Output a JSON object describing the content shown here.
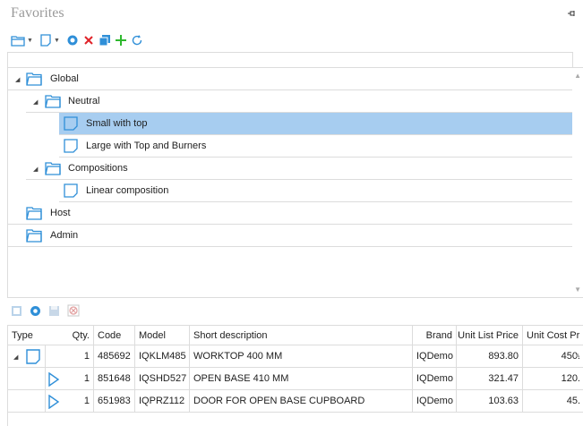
{
  "panel": {
    "title": "Favorites"
  },
  "tree": {
    "items": [
      {
        "label": "Global",
        "kind": "folder",
        "level": 0,
        "expanded": true,
        "selected": false
      },
      {
        "label": "Neutral",
        "kind": "folder",
        "level": 1,
        "expanded": true,
        "selected": false
      },
      {
        "label": "Small with top",
        "kind": "document",
        "level": 2,
        "selected": true
      },
      {
        "label": "Large with Top and Burners",
        "kind": "document",
        "level": 2,
        "selected": false
      },
      {
        "label": "Compositions",
        "kind": "folder",
        "level": 1,
        "expanded": true,
        "selected": false
      },
      {
        "label": "Linear composition",
        "kind": "document",
        "level": 2,
        "selected": false
      },
      {
        "label": "Host",
        "kind": "folder",
        "level": 0,
        "selected": false
      },
      {
        "label": "Admin",
        "kind": "folder",
        "level": 0,
        "selected": false
      }
    ]
  },
  "grid": {
    "columns": {
      "type": "Type",
      "qty": "Qty.",
      "code": "Code",
      "model": "Model",
      "desc": "Short description",
      "brand": "Brand",
      "ulp": "Unit List Price",
      "ucp": "Unit Cost Pr"
    },
    "rows": [
      {
        "qty": "1",
        "code": "485692",
        "model": "IQKLM485",
        "desc": "WORKTOP 400 MM",
        "brand": "IQDemo",
        "ulp": "893.80",
        "ucp": "450."
      },
      {
        "qty": "1",
        "code": "851648",
        "model": "IQSHD527",
        "desc": "OPEN BASE 410 MM",
        "brand": "IQDemo",
        "ulp": "321.47",
        "ucp": "120."
      },
      {
        "qty": "1",
        "code": "651983",
        "model": "IQPRZ112",
        "desc": "DOOR FOR OPEN BASE CUPBOARD",
        "brand": "IQDemo",
        "ulp": "103.63",
        "ucp": "45."
      }
    ]
  },
  "colors": {
    "selection": "#a7cdf0",
    "folder": "#2f8fd8",
    "delete": "#e0242a",
    "add": "#2eb82e"
  }
}
